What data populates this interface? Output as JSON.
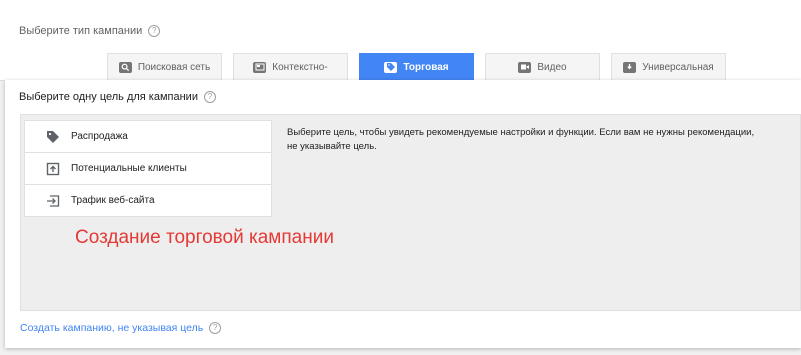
{
  "campaign_type": {
    "label": "Выберите тип кампании",
    "tabs": [
      {
        "label": "Поисковая сеть",
        "icon": "search-icon"
      },
      {
        "label": "Контекстно-",
        "icon": "display-icon"
      },
      {
        "label": "Торговая",
        "icon": "tag-icon",
        "active": true
      },
      {
        "label": "Видео",
        "icon": "video-icon"
      },
      {
        "label": "Универсальная",
        "icon": "download-icon"
      }
    ]
  },
  "goal": {
    "label": "Выберите одну цель для кампании",
    "items": [
      {
        "label": "Распродажа",
        "icon": "tag-icon"
      },
      {
        "label": "Потенциальные клиенты",
        "icon": "leads-icon"
      },
      {
        "label": "Трафик веб-сайта",
        "icon": "website-traffic-icon"
      }
    ],
    "hint": "Выберите цель, чтобы увидеть рекомендуемые настройки и функции. Если вам не нужны рекомендации, не указывайте цель."
  },
  "overlay_title": "Создание торговой кампании",
  "footer_link": "Создать кампанию, не указывая цель",
  "colors": {
    "accent": "#4285f4",
    "overlay_text": "#e53935"
  }
}
